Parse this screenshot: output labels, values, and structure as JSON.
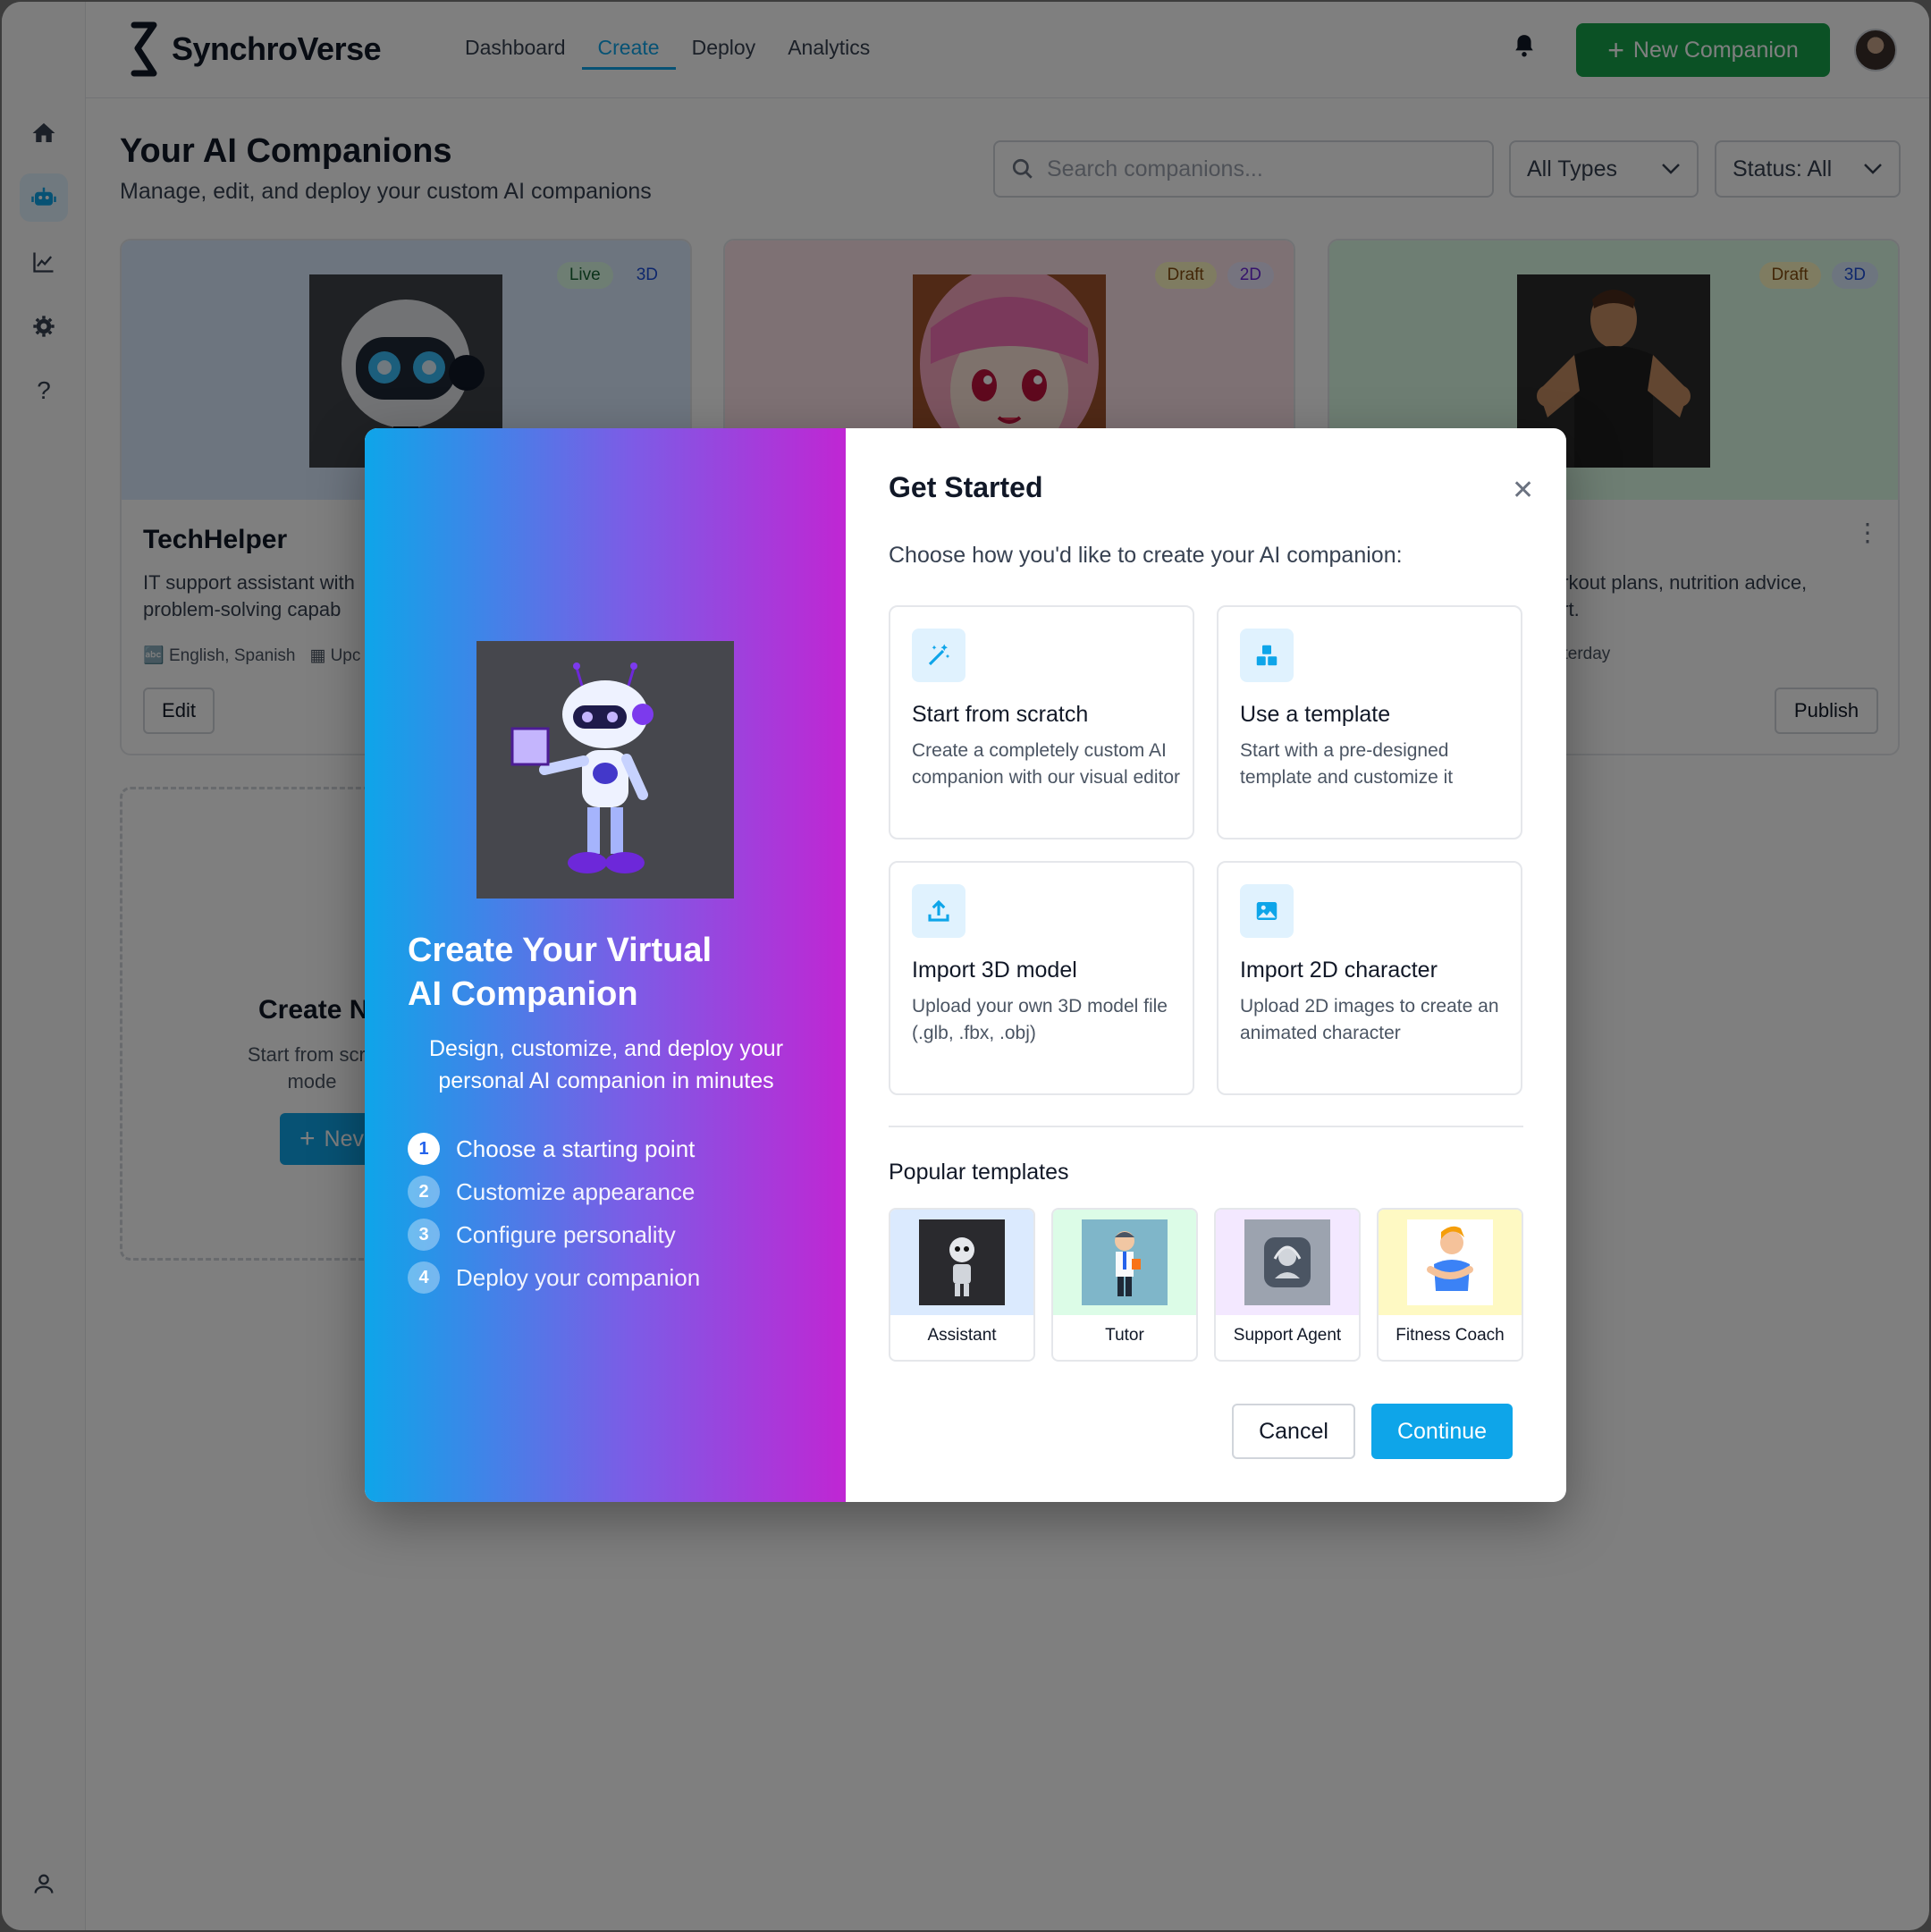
{
  "app": {
    "name": "SynchroVerse"
  },
  "nav": [
    {
      "label": "Dashboard"
    },
    {
      "label": "Create"
    },
    {
      "label": "Deploy"
    },
    {
      "label": "Analytics"
    }
  ],
  "header": {
    "new_companion": "New Companion"
  },
  "sidebar": {
    "icons": [
      "home-icon",
      "robot-icon",
      "chart-icon",
      "gear-icon",
      "help-icon",
      "user-icon"
    ]
  },
  "page": {
    "title": "Your AI Companions",
    "subtitle": "Manage, edit, and deploy your custom AI companions",
    "search_placeholder": "Search companions...",
    "type_filter": "All Types",
    "status_filter": "Status: All"
  },
  "cards": [
    {
      "name": "TechHelper",
      "desc_l1": "IT support assistant with",
      "desc_l2": "problem-solving capab",
      "languages": "English, Spanish",
      "updated": "Upc",
      "status": "Live",
      "mode": "3D",
      "button": "Edit"
    },
    {
      "status": "Draft",
      "mode": "2D"
    },
    {
      "desc_l1": "orkout plans, nutrition advice,",
      "desc_l2": "ort.",
      "updated": "sterday",
      "status": "Draft",
      "mode": "3D",
      "button": "Publish"
    }
  ],
  "create_card": {
    "title": "Create N",
    "desc_l1": "Start from scra",
    "desc_l2": "mode",
    "button": "Nev"
  },
  "modal": {
    "left": {
      "title_l1": "Create Your Virtual",
      "title_l2": "AI Companion",
      "subtitle_l1": "Design, customize, and deploy your",
      "subtitle_l2": "personal AI companion in minutes",
      "steps": [
        {
          "num": "1",
          "label": "Choose a starting point"
        },
        {
          "num": "2",
          "label": "Customize appearance"
        },
        {
          "num": "3",
          "label": "Configure personality"
        },
        {
          "num": "4",
          "label": "Deploy your companion"
        }
      ]
    },
    "title": "Get Started",
    "subtitle": "Choose how you'd like to create your AI companion:",
    "options": [
      {
        "icon": "magic-wand-icon",
        "title": "Start from scratch",
        "desc": "Create a completely custom AI companion with our visual editor"
      },
      {
        "icon": "cubes-icon",
        "title": "Use a template",
        "desc": "Start with a pre-designed template and customize it"
      },
      {
        "icon": "upload-icon",
        "title": "Import 3D model",
        "desc": "Upload your own 3D model file (.glb, .fbx, .obj)"
      },
      {
        "icon": "image-icon",
        "title": "Import 2D character",
        "desc": "Upload 2D images to create an animated character"
      }
    ],
    "popular_title": "Popular templates",
    "templates": [
      {
        "label": "Assistant",
        "bg": "#dbeafe"
      },
      {
        "label": "Tutor",
        "bg": "#dcfce7"
      },
      {
        "label": "Support Agent",
        "bg": "#f3e8ff"
      },
      {
        "label": "Fitness Coach",
        "bg": "#fef9c3"
      }
    ],
    "cancel": "Cancel",
    "continue": "Continue"
  },
  "colors": {
    "accent": "#0ea5e9",
    "green": "#16a34a"
  }
}
